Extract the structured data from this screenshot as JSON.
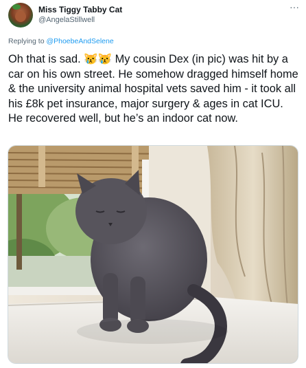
{
  "author": {
    "name": "Miss Tiggy Tabby Cat",
    "handle": "@AngelaStillwell"
  },
  "menu": {
    "more_label": "···"
  },
  "reply": {
    "prefix": "Replying to ",
    "mention": "@PhoebeAndSelene"
  },
  "tweet": {
    "text": "Oh that is sad. 😿😿 My cousin Dex (in pic) was hit by a car on his own street. He somehow dragged himself home & the university animal hospital vets saved him - it took all his £8k pet insurance, major surgery & ages in cat ICU. He recovered well, but he’s an indoor cat now."
  },
  "media": {
    "icon": "photo-cat-on-windowsill"
  }
}
